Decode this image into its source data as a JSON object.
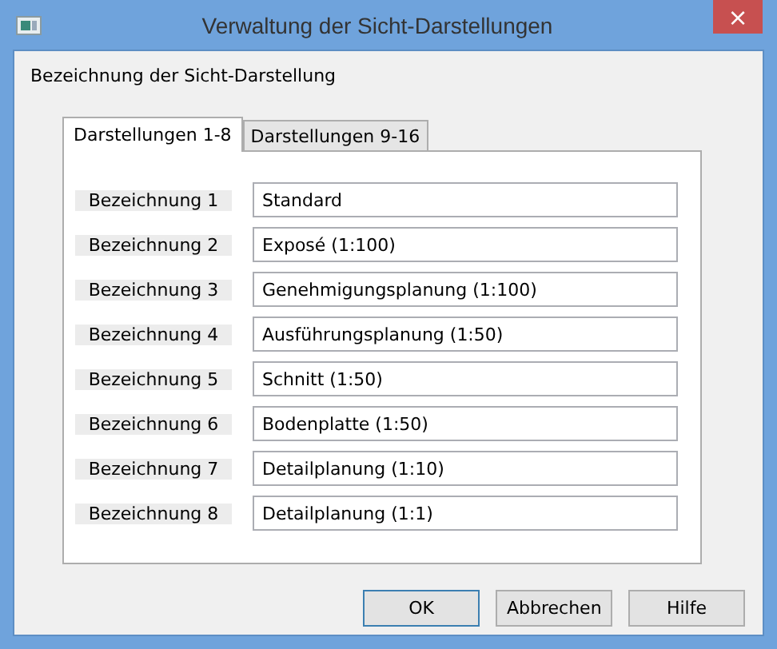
{
  "window": {
    "title": "Verwaltung der Sicht-Darstellungen",
    "close": "×"
  },
  "group_label": "Bezeichnung der Sicht-Darstellung",
  "tabs": [
    {
      "label": "Darstellungen 1-8",
      "selected": true
    },
    {
      "label": "Darstellungen 9-16",
      "selected": false
    }
  ],
  "rows": [
    {
      "label": "Bezeichnung 1",
      "value": "Standard"
    },
    {
      "label": "Bezeichnung 2",
      "value": "Exposé (1:100)"
    },
    {
      "label": "Bezeichnung 3",
      "value": "Genehmigungsplanung (1:100)"
    },
    {
      "label": "Bezeichnung 4",
      "value": "Ausführungsplanung (1:50)"
    },
    {
      "label": "Bezeichnung 5",
      "value": "Schnitt (1:50)"
    },
    {
      "label": "Bezeichnung 6",
      "value": "Bodenplatte (1:50)"
    },
    {
      "label": "Bezeichnung 7",
      "value": "Detailplanung (1:10)"
    },
    {
      "label": "Bezeichnung 8",
      "value": "Detailplanung (1:1)"
    }
  ],
  "buttons": [
    {
      "label": "OK",
      "default": true
    },
    {
      "label": "Abbrechen",
      "default": false
    },
    {
      "label": "Hilfe",
      "default": false
    }
  ]
}
